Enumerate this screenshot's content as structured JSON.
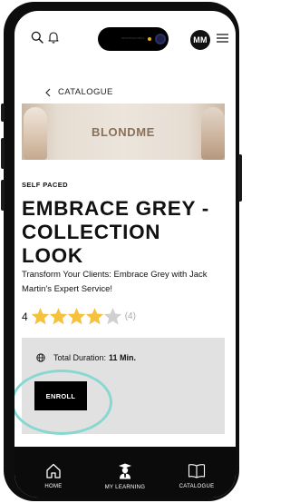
{
  "header": {
    "avatar_initials": "MM",
    "icons": [
      "search-icon",
      "bell-icon",
      "hamburger-menu-icon"
    ]
  },
  "breadcrumb": {
    "label": "CATALOGUE",
    "icon": "chevron-left-icon"
  },
  "banner": {
    "brand_text": "BLONDME"
  },
  "course": {
    "type": "SELF PACED",
    "title_line1": "EMBRACE GREY -",
    "title_line2": "COLLECTION LOOK",
    "description": "Transform Your Clients: Embrace Grey with Jack Martin's Expert Service!",
    "rating_value": "4",
    "rating_stars_filled": 4,
    "rating_stars_total": 5,
    "rating_count": "(4)",
    "duration_label": "Total Duration:",
    "duration_value": "11 Min.",
    "enroll_label": "ENROLL"
  },
  "tabs": [
    {
      "label": "HOME",
      "icon": "home-icon"
    },
    {
      "label": "MY LEARNING",
      "icon": "graduate-icon"
    },
    {
      "label": "CATALOGUE",
      "icon": "book-icon"
    }
  ],
  "colors": {
    "accent_star": "#f4c23c",
    "star_empty": "#d0d0d0",
    "highlight_ring": "#88d8d1",
    "panel_bg": "#e1e1e1",
    "tabbar_bg": "#0b0b0b"
  }
}
